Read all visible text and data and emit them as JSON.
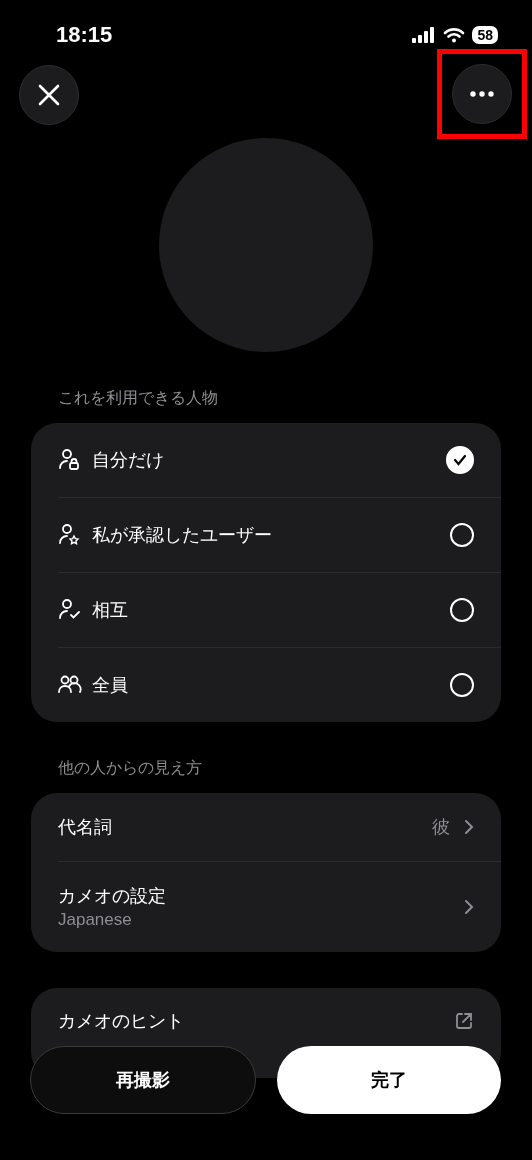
{
  "status_bar": {
    "time": "18:15",
    "battery": "58"
  },
  "more_button": {
    "highlighted": true
  },
  "audience": {
    "heading": "これを利用できる人物",
    "options": [
      {
        "kind": "lock",
        "label": "自分だけ",
        "selected": true
      },
      {
        "kind": "star",
        "label": "私が承認したユーザー",
        "selected": false
      },
      {
        "kind": "check",
        "label": "相互",
        "selected": false
      },
      {
        "kind": "group",
        "label": "全員",
        "selected": false
      }
    ]
  },
  "appearance": {
    "heading": "他の人からの見え方",
    "items": [
      {
        "label": "代名詞",
        "value": "彼"
      },
      {
        "label": "カメオの設定",
        "subtitle": "Japanese"
      }
    ]
  },
  "hint": {
    "label": "カメオのヒント"
  },
  "buttons": [
    {
      "kind": "secondary",
      "label": "再撮影"
    },
    {
      "kind": "primary",
      "label": "完了"
    }
  ]
}
